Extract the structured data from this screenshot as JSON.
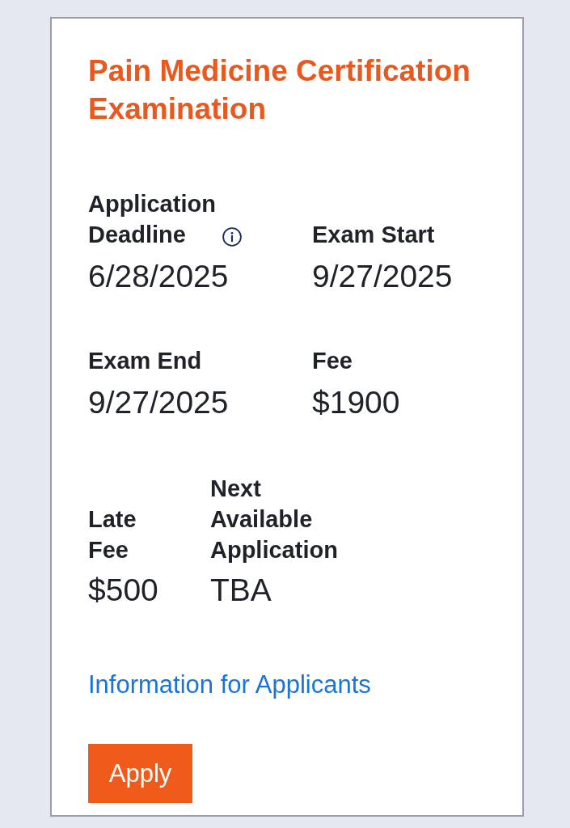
{
  "card": {
    "title": "Pain Medicine Certification Examination",
    "details": [
      {
        "label": "Application Deadline",
        "value": "6/28/2025",
        "info": true
      },
      {
        "label": "Exam Start",
        "value": "9/27/2025",
        "info": false
      },
      {
        "label": "Exam End",
        "value": "9/27/2025",
        "info": false
      },
      {
        "label": "Fee",
        "value": "$1900",
        "info": false
      }
    ],
    "extra_details": [
      {
        "label": "Late Fee",
        "value": "$500"
      },
      {
        "label": "Next Available Application",
        "value": "TBA"
      }
    ],
    "link": "Information for Applicants",
    "button": "Apply"
  }
}
